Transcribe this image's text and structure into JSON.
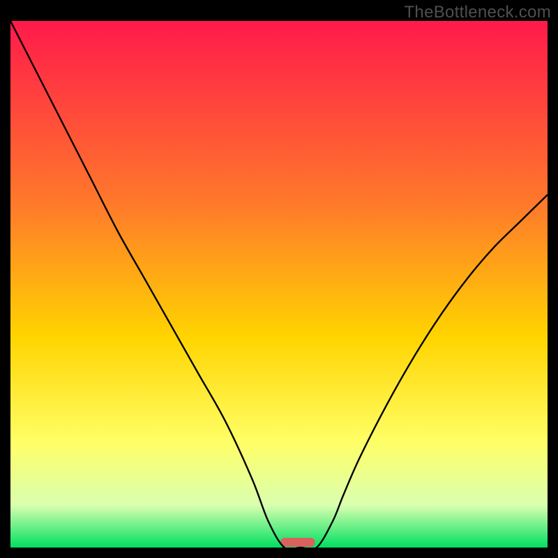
{
  "watermark": "TheBottleneck.com",
  "chart_data": {
    "type": "line",
    "title": "",
    "xlabel": "",
    "ylabel": "",
    "xlim": [
      0,
      100
    ],
    "ylim": [
      0,
      100
    ],
    "gradient_stops": [
      {
        "offset": 0,
        "color": "#ff1a4b"
      },
      {
        "offset": 35,
        "color": "#ff7a2a"
      },
      {
        "offset": 60,
        "color": "#ffd400"
      },
      {
        "offset": 80,
        "color": "#ffff66"
      },
      {
        "offset": 92,
        "color": "#d9ffb0"
      },
      {
        "offset": 100,
        "color": "#00e060"
      }
    ],
    "series": [
      {
        "name": "V-curve",
        "x": [
          0,
          5,
          10,
          15,
          20,
          25,
          30,
          35,
          40,
          45,
          48,
          51,
          54,
          57,
          60,
          62,
          65,
          70,
          75,
          80,
          85,
          90,
          95,
          100
        ],
        "values": [
          100,
          90,
          80,
          70,
          60,
          51,
          42,
          33,
          24,
          13,
          5,
          0,
          0,
          0,
          5,
          10,
          17,
          27,
          36,
          44,
          51,
          57,
          62,
          67
        ]
      }
    ],
    "marker": {
      "x_center": 53.5,
      "x_half_width": 3.2,
      "color": "#d9625f"
    }
  }
}
